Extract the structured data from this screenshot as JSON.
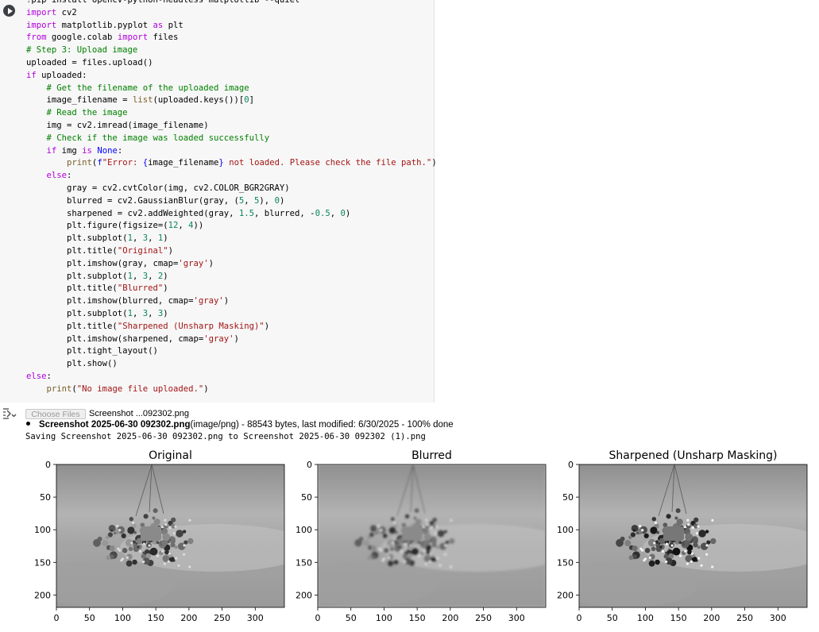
{
  "code_cell": {
    "lines": [
      "!pip install opencv-python-headless matplotlib --quiet",
      "import cv2",
      "import matplotlib.pyplot as plt",
      "from google.colab import files",
      "# Step 3: Upload image",
      "uploaded = files.upload()",
      "if uploaded:",
      "    # Get the filename of the uploaded image",
      "    image_filename = list(uploaded.keys())[0]",
      "    # Read the image",
      "    img = cv2.imread(image_filename)",
      "    # Check if the image was loaded successfully",
      "    if img is None:",
      "        print(f\"Error: {image_filename} not loaded. Please check the file path.\")",
      "    else:",
      "        gray = cv2.cvtColor(img, cv2.COLOR_BGR2GRAY)",
      "        blurred = cv2.GaussianBlur(gray, (5, 5), 0)",
      "        sharpened = cv2.addWeighted(gray, 1.5, blurred, -0.5, 0)",
      "        plt.figure(figsize=(12, 4))",
      "        plt.subplot(1, 3, 1)",
      "        plt.title(\"Original\")",
      "        plt.imshow(gray, cmap='gray')",
      "        plt.subplot(1, 3, 2)",
      "        plt.title(\"Blurred\")",
      "        plt.imshow(blurred, cmap='gray')",
      "        plt.subplot(1, 3, 3)",
      "        plt.title(\"Sharpened (Unsharp Masking)\")",
      "        plt.imshow(sharpened, cmap='gray')",
      "        plt.tight_layout()",
      "        plt.show()",
      "else:",
      "    print(\"No image file uploaded.\")"
    ]
  },
  "output": {
    "choose_files_label": "Choose Files",
    "chosen_file": "Screenshot ...092302.png",
    "file_name": "Screenshot 2025-06-30 092302.png",
    "file_meta": "(image/png) - 88543 bytes, last modified: 6/30/2025 - 100% done",
    "saving_line": "Saving Screenshot 2025-06-30 092302.png to Screenshot 2025-06-30 092302 (1).png"
  },
  "chart_data": {
    "type": "image",
    "panels": [
      {
        "title": "Original",
        "blur": 0
      },
      {
        "title": "Blurred",
        "blur": 1.2
      },
      {
        "title": "Sharpened (Unsharp Masking)",
        "blur": 0
      }
    ],
    "x_ticks": [
      "0",
      "50",
      "100",
      "150",
      "200",
      "250",
      "300"
    ],
    "y_ticks": [
      "0",
      "50",
      "100",
      "150",
      "200"
    ],
    "xlim": [
      0,
      344
    ],
    "ylim": [
      219,
      0
    ]
  }
}
